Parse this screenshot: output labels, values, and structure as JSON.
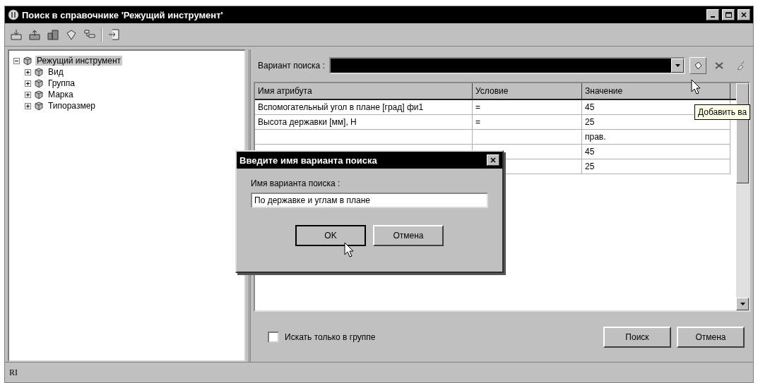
{
  "window": {
    "title": "Поиск в справочнике 'Режущий инструмент'"
  },
  "tree": {
    "label": "Режущий инструмент",
    "expanded": true,
    "selected": true,
    "children": [
      {
        "label": "Вид",
        "expanded": false
      },
      {
        "label": "Группа",
        "expanded": false
      },
      {
        "label": "Марка",
        "expanded": false
      },
      {
        "label": "Типоразмер",
        "expanded": false
      }
    ]
  },
  "search_variant": {
    "label": "Вариант поиска :"
  },
  "tooltip": "Добавить ва",
  "table": {
    "columns": [
      "Имя атрибута",
      "Условие",
      "Значение"
    ],
    "rows": [
      {
        "attribute": "Вспомогательный угол в плане [град] фи1",
        "condition": "=",
        "value": "45"
      },
      {
        "attribute": "Высота державки [мм], H",
        "condition": "=",
        "value": "25"
      },
      {
        "value": "прав."
      },
      {
        "value": "45"
      },
      {
        "value": "25"
      }
    ]
  },
  "only_in_group": {
    "label": "Искать только в группе",
    "checked": false
  },
  "buttons": [
    "Поиск",
    "Отмена"
  ],
  "status_bar": "RI",
  "dialog": {
    "title": "Введите имя варианта поиска",
    "field_label": "Имя варианта поиска :",
    "value": "По державке и углам в плане",
    "buttons": [
      "OK",
      "Отмена"
    ]
  }
}
